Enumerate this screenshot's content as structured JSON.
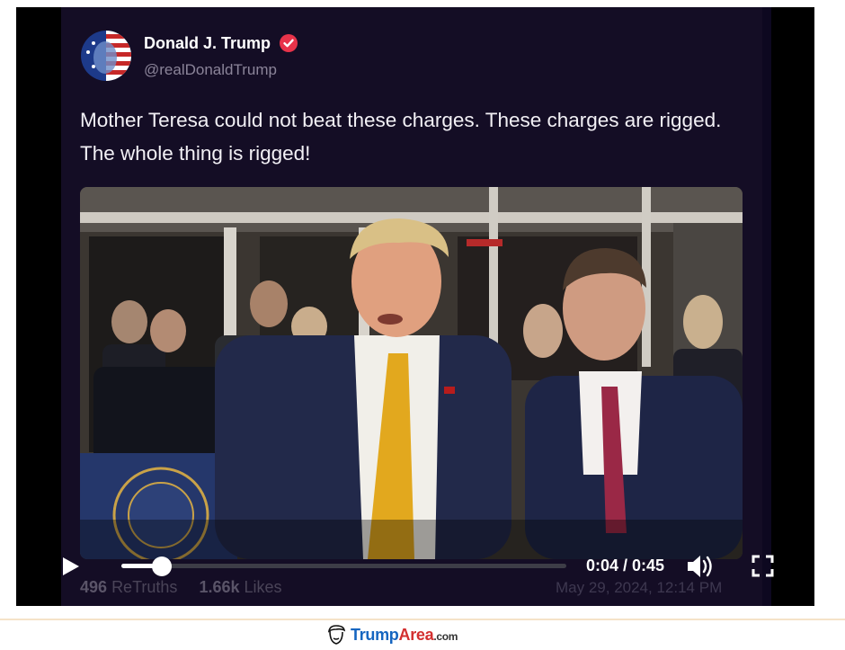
{
  "post": {
    "author_name": "Donald J. Trump",
    "author_handle": "@realDonaldTrump",
    "text": "Mother Teresa could not beat these charges. These charges are rigged. The whole thing is rigged!"
  },
  "video": {
    "current_time": "0:04",
    "duration": "0:45",
    "time_display": "0:04 / 0:45",
    "progress_fraction": 0.09,
    "icons": [
      "play-icon",
      "volume-icon",
      "fullscreen-icon"
    ]
  },
  "stats": {
    "retruths_count": "496",
    "retruths_label": "ReTruths",
    "likes_count": "1.66k",
    "likes_label": "Likes",
    "timestamp": "May 29, 2024, 12:14 PM"
  },
  "watermark": {
    "brand_part1": "Trump",
    "brand_part2": "Area",
    "brand_suffix": ".com"
  },
  "colors": {
    "card_background": "#140d25",
    "verified_badge": "#e8334a",
    "brand_blue": "#1565c0",
    "brand_red": "#d32f2f"
  }
}
